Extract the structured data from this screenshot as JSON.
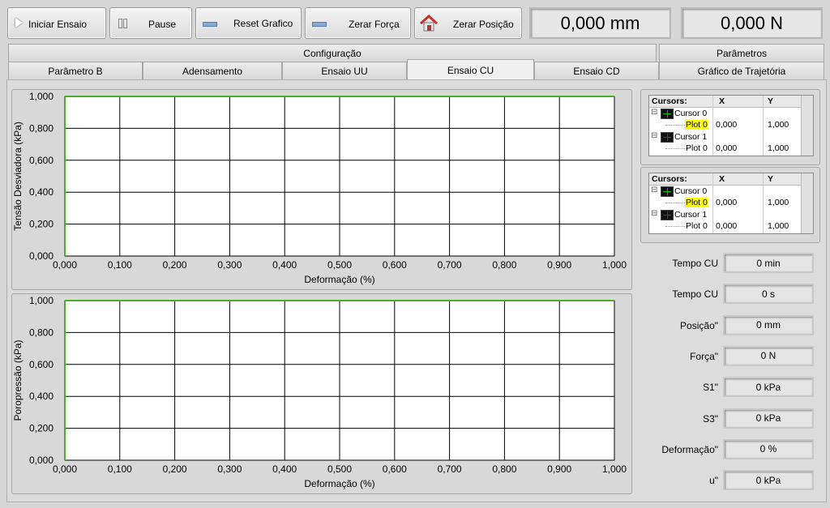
{
  "toolbar": {
    "start_label": "Iniciar Ensaio",
    "pause_label": "Pause",
    "reset_graph_label": "Reset Grafico",
    "zero_force_label": "Zerar Força",
    "zero_position_label": "Zerar Posição",
    "position_readout": "0,000 mm",
    "force_readout": "0,000 N"
  },
  "tabs_top": [
    {
      "label": "Configuração"
    },
    {
      "label": "Parâmetros"
    }
  ],
  "tabs_bottom": [
    {
      "label": "Parâmetro B"
    },
    {
      "label": "Adensamento"
    },
    {
      "label": "Ensaio UU"
    },
    {
      "label": "Ensaio CU"
    },
    {
      "label": "Ensaio CD"
    },
    {
      "label": "Gráfico de Trajetória"
    }
  ],
  "active_tab": "Ensaio CU",
  "chart_data": [
    {
      "type": "line",
      "ylabel": "Tensão Desviadora (kPa)",
      "xlabel": "Deformação (%)",
      "xlim": [
        0,
        1
      ],
      "ylim": [
        0,
        1
      ],
      "x_ticks": [
        "0,000",
        "0,100",
        "0,200",
        "0,300",
        "0,400",
        "0,500",
        "0,600",
        "0,700",
        "0,800",
        "0,900",
        "1,000"
      ],
      "y_ticks": [
        "0,000",
        "0,200",
        "0,400",
        "0,600",
        "0,800",
        "1,000"
      ],
      "grid": true,
      "series": []
    },
    {
      "type": "line",
      "ylabel": "Poropressão (kPa)",
      "xlabel": "Deformação (%)",
      "xlim": [
        0,
        1
      ],
      "ylim": [
        0,
        1
      ],
      "x_ticks": [
        "0,000",
        "0,100",
        "0,200",
        "0,300",
        "0,400",
        "0,500",
        "0,600",
        "0,700",
        "0,800",
        "0,900",
        "1,000"
      ],
      "y_ticks": [
        "0,000",
        "0,200",
        "0,400",
        "0,600",
        "0,800",
        "1,000"
      ],
      "grid": true,
      "series": []
    }
  ],
  "cursor_panels": [
    {
      "header": {
        "name": "Cursors:",
        "x": "X",
        "y": "Y"
      },
      "cursors": [
        {
          "name": "Cursor 0",
          "plot": "Plot 0",
          "x": "0,000",
          "y": "1,000",
          "color": "#00c800",
          "plot_highlight": true
        },
        {
          "name": "Cursor 1",
          "plot": "Plot 0",
          "x": "0,000",
          "y": "1,000",
          "color": "#e00000",
          "plot_highlight": false
        }
      ]
    },
    {
      "header": {
        "name": "Cursors:",
        "x": "X",
        "y": "Y"
      },
      "cursors": [
        {
          "name": "Cursor 0",
          "plot": "Plot 0",
          "x": "0,000",
          "y": "1,000",
          "color": "#00c800",
          "plot_highlight": true
        },
        {
          "name": "Cursor 1",
          "plot": "Plot 0",
          "x": "0,000",
          "y": "1,000",
          "color": "#e00000",
          "plot_highlight": false
        }
      ]
    }
  ],
  "indicators": [
    {
      "label": "Tempo CU",
      "value": "0 min"
    },
    {
      "label": "Tempo CU",
      "value": "0 s"
    },
    {
      "label": "Posição\"",
      "value": "0 mm"
    },
    {
      "label": "Força\"",
      "value": "0 N"
    },
    {
      "label": "S1\"",
      "value": "0 kPa"
    },
    {
      "label": "S3\"",
      "value": "0 kPa"
    },
    {
      "label": "Deformação\"",
      "value": "0 %"
    },
    {
      "label": "u\"",
      "value": "0 kPa"
    }
  ],
  "colors": {
    "plot_line": "#4caf2a",
    "highlight": "#ffff00"
  }
}
